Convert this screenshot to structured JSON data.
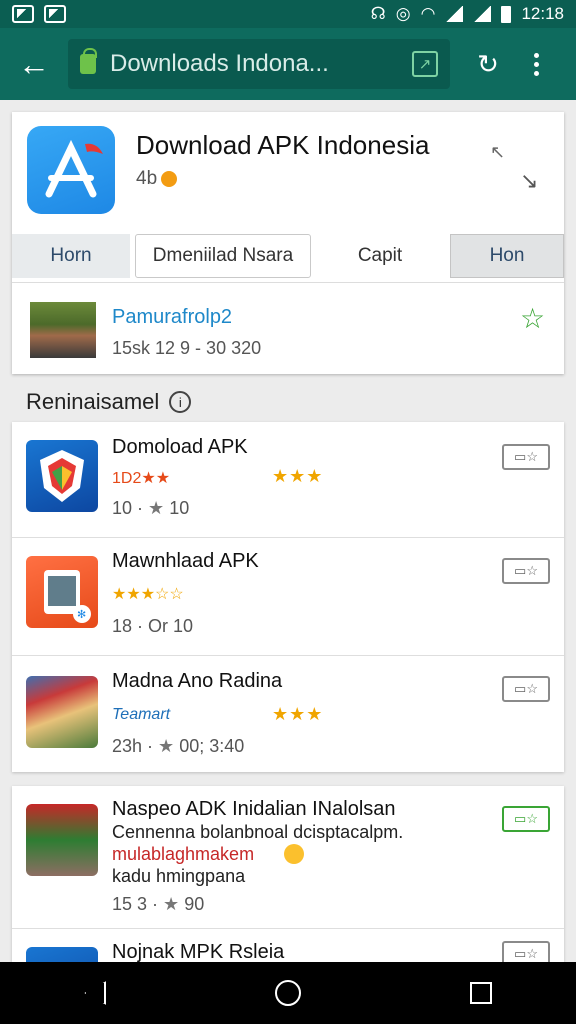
{
  "status_bar": {
    "time": "12:18"
  },
  "browser": {
    "url": "Downloads Indona...",
    "icons": {
      "back": "arrow-left-icon",
      "secure": "lock-icon",
      "extension": "extension-icon",
      "reload": "reload-icon",
      "menu": "more-vert-icon"
    }
  },
  "header": {
    "title": "Download APK Indonesia",
    "subtitle": "4b",
    "tabs": [
      {
        "label": "Horn"
      },
      {
        "label": "Dmeniilad Nsara"
      },
      {
        "label": "Capit"
      },
      {
        "label": "Hon"
      }
    ],
    "featured": {
      "name": "Pamurafrolp2",
      "meta": "15sk 12 9 - 30 320"
    }
  },
  "section": {
    "title": "Reninaisamel"
  },
  "apps": [
    {
      "name": "Domoload APK",
      "badge": "1D2★★",
      "stars": "★★★",
      "meta_left": "10 ·",
      "meta_right": "10"
    },
    {
      "name": "Mawnhlaad APK",
      "badge": "★★★☆☆",
      "stars": "",
      "meta_left": "18 ·",
      "meta_right": "Or 10"
    },
    {
      "name": "Madna Ano Radina",
      "badge": "Teamart",
      "stars": "★★★",
      "meta_left": "23h ·",
      "meta_right": "00; 3:40"
    },
    {
      "name": "Naspeo ADK Inidalian INalolsan",
      "line2": "Cennenna bolanbnoal dcisptacalpm.",
      "line3": "mulablaghmakem",
      "line4": "kadu hmingpana",
      "meta_left": "15 3 ·",
      "meta_right": "90"
    },
    {
      "name": "Nojnak MPK Rsleia"
    }
  ],
  "colors": {
    "appbar": "#0e6b5e",
    "statusbar": "#0b5e52",
    "accent_green": "#3aa535",
    "star": "#f0a500"
  }
}
